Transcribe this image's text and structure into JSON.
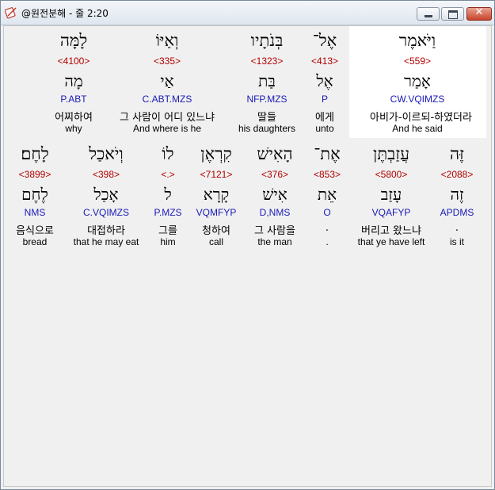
{
  "window": {
    "title": "@원전분해 - 줄 2:20",
    "icon": "book-pen-icon",
    "buttons": {
      "minimize": "",
      "maximize": "",
      "close": "✕"
    }
  },
  "colors": {
    "strong_number": "#b30000",
    "morphology": "#1a1ab8",
    "highlight": "#ffffff"
  },
  "rows": [
    {
      "words": [
        {
          "hebrew": "וַיֹּאמֶר",
          "strong": "<559>",
          "lemma": "אָמַר",
          "morph": "CW.VQIMZS",
          "korean": "아비가-이르되-하였더라",
          "english": "And he said",
          "selected": true
        },
        {
          "hebrew": "אֶל־",
          "strong": "<413>",
          "lemma": "אֶל",
          "morph": "P",
          "korean": "에게",
          "english": "unto"
        },
        {
          "hebrew": "בְּנֹתָיו",
          "strong": "<1323>",
          "lemma": "בַּת",
          "morph": "NFP.MZS",
          "korean": "딸들",
          "english": "his daughters"
        },
        {
          "hebrew": "וְאַיּוֹ",
          "strong": "<335>",
          "lemma": "אַי",
          "morph": "C.ABT.MZS",
          "korean": "그 사람이 어디 있느냐",
          "english": "And where is he"
        },
        {
          "hebrew": "לָמָּה",
          "strong": "<4100>",
          "lemma": "מָה",
          "morph": "P.ABT",
          "korean": "어찌하여",
          "english": "why"
        }
      ]
    },
    {
      "words": [
        {
          "hebrew": "זֶּה",
          "strong": "<2088>",
          "lemma": "זֶה",
          "morph": "APDMS",
          "korean": ".",
          "english": "is it"
        },
        {
          "hebrew": "עֲזַבְתֶּן",
          "strong": "<5800>",
          "lemma": "עָזַב",
          "morph": "VQAFYP",
          "korean": "버리고 왔느냐",
          "english": "that ye have left"
        },
        {
          "hebrew": "אֶת־",
          "strong": "<853>",
          "lemma": "אֵת",
          "morph": "O",
          "korean": ".",
          "english": "."
        },
        {
          "hebrew": "הָאִישׁ",
          "strong": "<376>",
          "lemma": "אִישׁ",
          "morph": "D,NMS",
          "korean": "그 사람을",
          "english": "the man"
        },
        {
          "hebrew": "קִרְאֶן",
          "strong": "<7121>",
          "lemma": "קָרָא",
          "morph": "VQMFYP",
          "korean": "청하여",
          "english": "call"
        },
        {
          "hebrew": "לוֹ",
          "strong": "<.>",
          "lemma": "ל",
          "morph": "P.MZS",
          "korean": "그를",
          "english": "him"
        },
        {
          "hebrew": "וְיֹאכַל",
          "strong": "<398>",
          "lemma": "אָכַל",
          "morph": "C.VQIMZS",
          "korean": "대접하라",
          "english": "that he may eat"
        },
        {
          "hebrew": "לָחֶם׃",
          "strong": "<3899>",
          "lemma": "לֶחֶם",
          "morph": "NMS",
          "korean": "음식으로",
          "english": "bread"
        }
      ]
    }
  ]
}
